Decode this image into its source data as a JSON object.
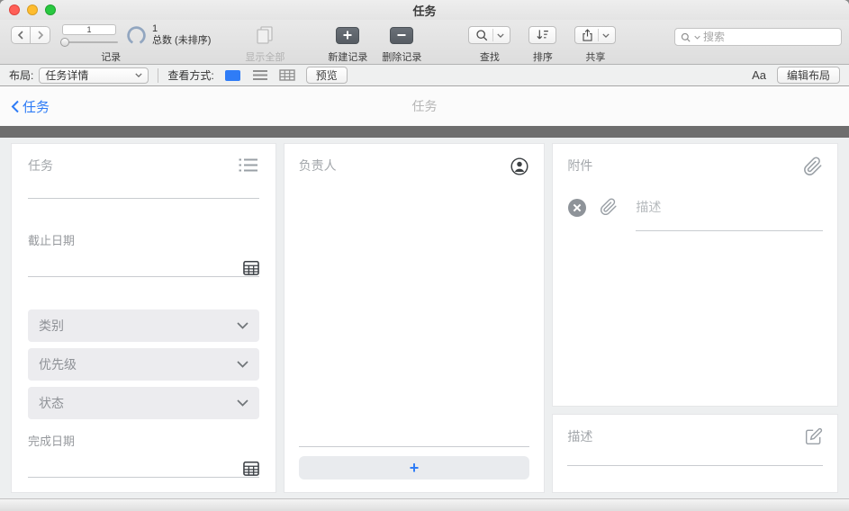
{
  "titlebar": {
    "title": "任务"
  },
  "toolbar": {
    "records": {
      "slider_value": "1",
      "count": "1",
      "total": "总数 (未排序)",
      "label": "记录"
    },
    "show_all": {
      "label": "显示全部"
    },
    "new_record": {
      "label": "新建记录"
    },
    "delete_record": {
      "label": "删除记录"
    },
    "find": {
      "label": "查找"
    },
    "sort": {
      "label": "排序"
    },
    "share": {
      "label": "共享"
    },
    "search": {
      "placeholder": "搜索"
    }
  },
  "layoutbar": {
    "layout_label": "布局:",
    "layout_selected": "任务详情",
    "view_label": "查看方式:",
    "preview": "预览",
    "format": "Aa",
    "edit_layout": "编辑布局"
  },
  "record_header": {
    "back": "任务",
    "title": "任务"
  },
  "task_panel": {
    "title": "任务",
    "due_date": "截止日期",
    "category": "类别",
    "priority": "优先级",
    "status": "状态",
    "completion_date": "完成日期"
  },
  "assignee_panel": {
    "title": "负责人",
    "add": "+"
  },
  "attachments_panel": {
    "title": "附件",
    "description": "描述"
  },
  "description_panel": {
    "title": "描述"
  },
  "colors": {
    "accent_blue": "#2f7cf6",
    "dark_bar": "#6e6e6e"
  }
}
